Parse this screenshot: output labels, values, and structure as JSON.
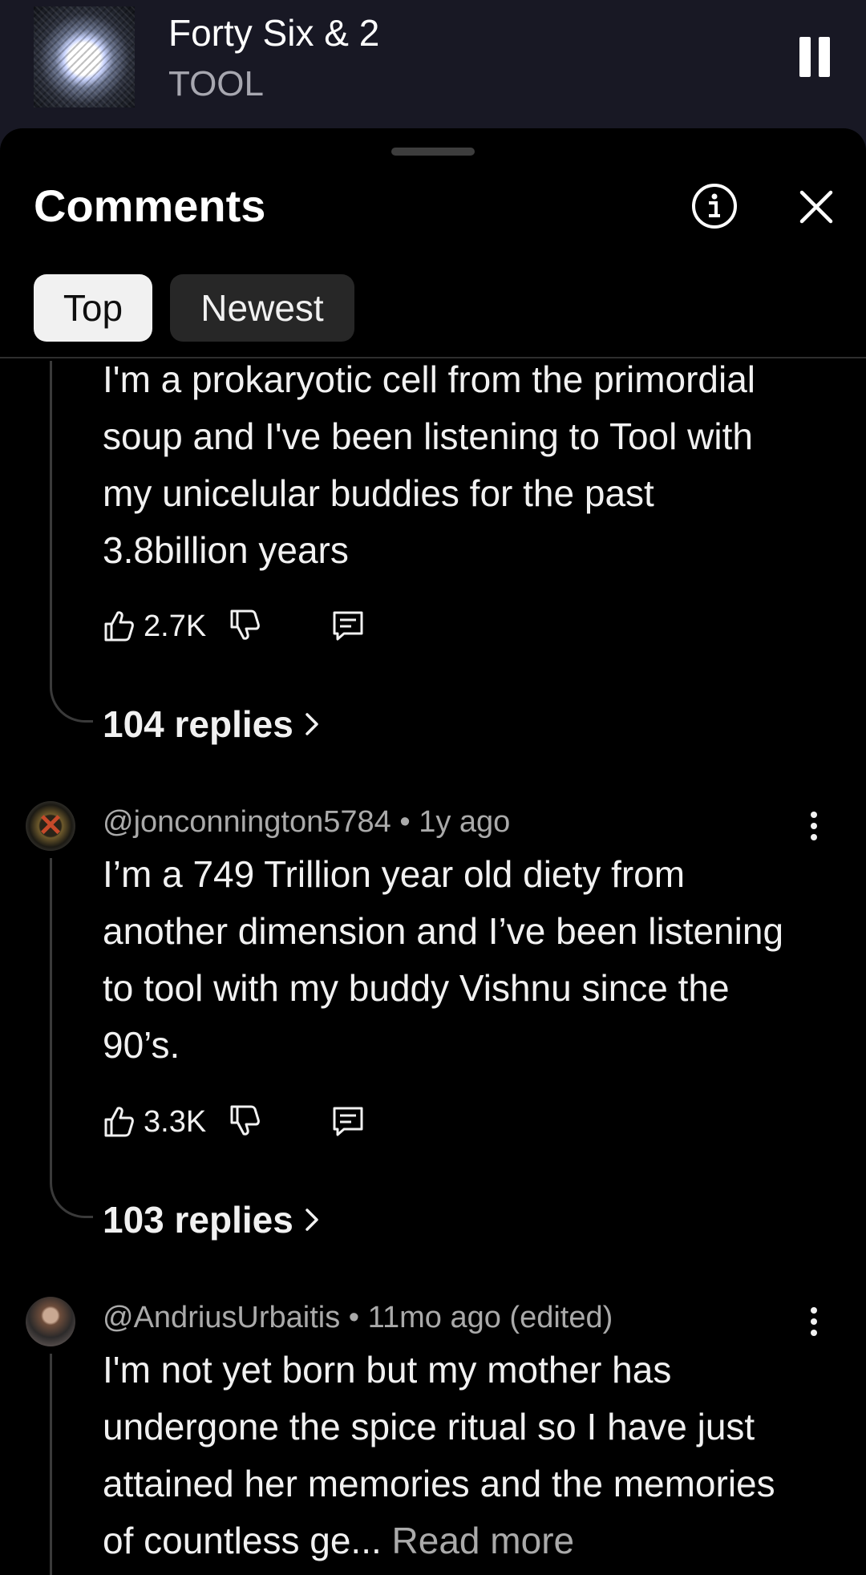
{
  "player": {
    "title": "Forty Six & 2",
    "artist": "TOOL"
  },
  "sheet": {
    "title": "Comments",
    "tabs": [
      {
        "label": "Top",
        "active": true
      },
      {
        "label": "Newest",
        "active": false
      }
    ]
  },
  "comments": [
    {
      "text": "I'm a prokaryotic cell from the primordial soup and I've been listening to Tool with my unicelular buddies for the past 3.8billion years",
      "likes": "2.7K",
      "replies": "104 replies"
    },
    {
      "author": "@jonconnington5784",
      "time": "1y ago",
      "text": "I’m a 749 Trillion year old diety from another dimension and I’ve been listening to tool with my buddy Vishnu since the 90’s.",
      "likes": "3.3K",
      "replies": "103 replies"
    },
    {
      "author": "@AndriusUrbaitis",
      "time": "11mo ago (edited)",
      "text": "I'm not yet born but my mother has undergone the spice ritual so I have just attained her memories and the memories of countless ge...",
      "read_more": "Read more"
    }
  ],
  "colors": {
    "background": "#000000",
    "player_bg": "#181824",
    "text_primary": "#f1f1f1",
    "text_secondary": "#aaaaaa",
    "chip_active": "#f1f1f1",
    "chip_inactive": "#272727"
  }
}
